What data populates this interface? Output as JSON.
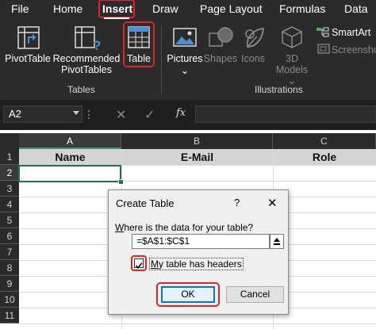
{
  "ribbon": {
    "tabs": [
      "File",
      "Home",
      "Insert",
      "Draw",
      "Page Layout",
      "Formulas",
      "Data"
    ],
    "active_tab": "Insert",
    "buttons": {
      "pivot_table": "PivotTable",
      "recommended_line1": "Recommended",
      "recommended_line2": "PivotTables",
      "table": "Table",
      "pictures": "Pictures",
      "shapes": "Shapes",
      "icons": "Icons",
      "models_line1": "3D",
      "models_line2": "Models",
      "smartart": "SmartArt",
      "screenshot": "Screenshot"
    },
    "groups": {
      "tables": "Tables",
      "illustrations": "Illustrations"
    },
    "colors": {
      "background": "#2b2b2b",
      "highlight": "#e0252a",
      "icon_blue": "#4a90d9"
    }
  },
  "formula_bar": {
    "name_box": "A2",
    "cancel_symbol": "✕",
    "enter_symbol": "✓",
    "fx_label": "fx",
    "formula": ""
  },
  "sheet": {
    "columns": [
      "A",
      "B",
      "C"
    ],
    "rows": [
      "1",
      "2",
      "3",
      "4",
      "5",
      "6",
      "7",
      "8",
      "9",
      "10",
      "11"
    ],
    "headers": [
      "Name",
      "E-Mail",
      "Role"
    ],
    "active_cell": "A2",
    "colors": {
      "header_row_fill": "#d4d4d4",
      "selection": "#217346"
    }
  },
  "dialog": {
    "title": "Create Table",
    "help": "?",
    "close": "✕",
    "question_underlined": "W",
    "question_rest": "here is the data for your table?",
    "range": "=$A$1:$C$1",
    "checkbox_checked": true,
    "checkbox_label_underlined": "M",
    "checkbox_label_rest": "y table has headers",
    "ok_label": "OK",
    "cancel_label": "Cancel"
  }
}
